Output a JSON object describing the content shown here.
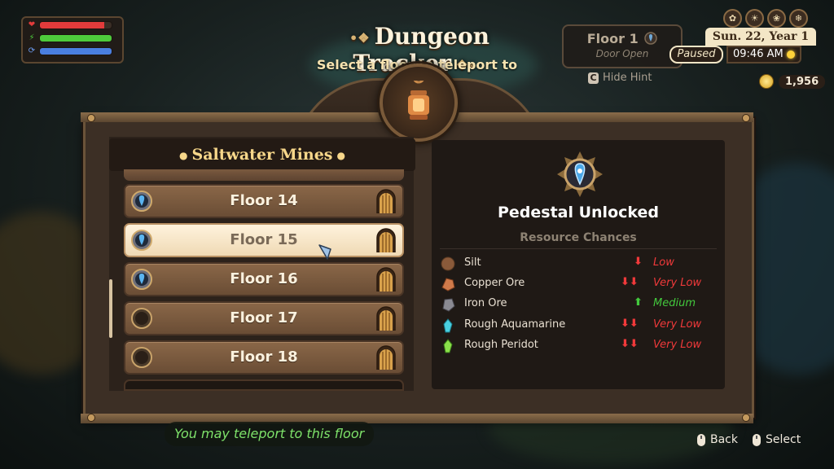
{
  "hud": {
    "stat_icons": [
      "heart-icon",
      "energy-icon",
      "mana-icon"
    ],
    "health_fraction": 0.9,
    "stamina_fraction": 1.0,
    "mana_fraction": 1.0,
    "colors": {
      "health": "#e23b3b",
      "stamina": "#4ecb3c",
      "mana": "#4a7fe0"
    }
  },
  "header": {
    "title": "Dungeon Tracker",
    "subtitle": "Select a floor to teleport to"
  },
  "floor_status": {
    "floor": "Floor 1",
    "door": "Door Open",
    "hint_key": "C",
    "hint_label": "Hide Hint"
  },
  "clock": {
    "seasons": [
      "spring-icon",
      "summer-icon",
      "fall-icon",
      "winter-icon"
    ],
    "date": "Sun. 22, Year 1",
    "paused": "Paused",
    "time": "09:46 AM",
    "money": "1,956"
  },
  "list": {
    "title": "Saltwater Mines",
    "floors": [
      {
        "label": "Floor 14",
        "unlocked": true,
        "selected": false
      },
      {
        "label": "Floor 15",
        "unlocked": true,
        "selected": true
      },
      {
        "label": "Floor 16",
        "unlocked": true,
        "selected": false
      },
      {
        "label": "Floor 17",
        "unlocked": false,
        "selected": false
      },
      {
        "label": "Floor 18",
        "unlocked": false,
        "selected": false
      }
    ]
  },
  "detail": {
    "title": "Pedestal Unlocked",
    "resources_title": "Resource Chances",
    "resources": [
      {
        "name": "Silt",
        "arrows": 1,
        "direction": "down",
        "chance": "Low",
        "icon": "silt-icon"
      },
      {
        "name": "Copper Ore",
        "arrows": 2,
        "direction": "down",
        "chance": "Very Low",
        "icon": "copper-ore-icon"
      },
      {
        "name": "Iron Ore",
        "arrows": 1,
        "direction": "up",
        "chance": "Medium",
        "icon": "iron-ore-icon"
      },
      {
        "name": "Rough Aquamarine",
        "arrows": 2,
        "direction": "down",
        "chance": "Very Low",
        "icon": "aquamarine-icon"
      },
      {
        "name": "Rough Peridot",
        "arrows": 2,
        "direction": "down",
        "chance": "Very Low",
        "icon": "peridot-icon"
      }
    ],
    "colors": {
      "down": "#f0393a",
      "up": "#43c93d"
    }
  },
  "footer": {
    "message": "You may teleport to this floor",
    "back": "Back",
    "select": "Select"
  }
}
